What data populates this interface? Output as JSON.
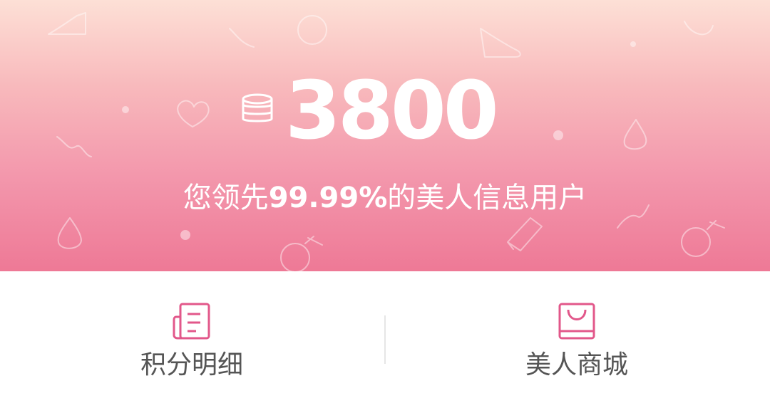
{
  "points": {
    "icon": "coin-stack-icon",
    "value": "3800"
  },
  "rank": {
    "prefix": "您领先",
    "percent": "99.99%",
    "suffix": "的美人信息用户"
  },
  "actions": [
    {
      "icon": "points-detail-icon",
      "label": "积分明细"
    },
    {
      "icon": "shopping-bag-icon",
      "label": "美人商城"
    }
  ],
  "colors": {
    "accent": "#e2578a",
    "hero_top": "#fde0d6",
    "hero_bottom": "#ee7996",
    "label": "#555555"
  }
}
